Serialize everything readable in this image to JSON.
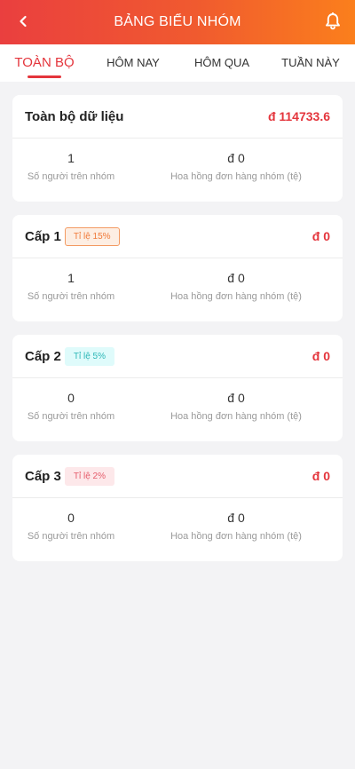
{
  "header": {
    "title": "BẢNG BIỂU NHÓM",
    "back_icon": "chevron-left-icon",
    "bell_icon": "bell-icon",
    "gradient_from": "#ea3f3f",
    "gradient_to": "#fb7f1c"
  },
  "tabs": [
    {
      "label": "TOÀN BỘ",
      "active": true
    },
    {
      "label": "HÔM NAY",
      "active": false
    },
    {
      "label": "HÔM QUA",
      "active": false
    },
    {
      "label": "TUẦN NÀY",
      "active": false
    }
  ],
  "accent": "#e4353c",
  "cards": [
    {
      "title": "Toàn bộ dữ liệu",
      "badge": "",
      "amount": "đ 114733.6",
      "members_value": "1",
      "members_label": "Số người trên nhóm",
      "commission_value": "đ 0",
      "commission_label": "Hoa hồng đơn hàng nhóm (tệ)"
    },
    {
      "title": "Cấp 1",
      "badge": "Tỉ lệ 15%",
      "amount": "đ 0",
      "members_value": "1",
      "members_label": "Số người trên nhóm",
      "commission_value": "đ 0",
      "commission_label": "Hoa hồng đơn hàng nhóm (tệ)"
    },
    {
      "title": "Cấp 2",
      "badge": "Tỉ lệ 5%",
      "amount": "đ 0",
      "members_value": "0",
      "members_label": "Số người trên nhóm",
      "commission_value": "đ 0",
      "commission_label": "Hoa hồng đơn hàng nhóm (tệ)"
    },
    {
      "title": "Cấp 3",
      "badge": "Tỉ lệ 2%",
      "amount": "đ 0",
      "members_value": "0",
      "members_label": "Số người trên nhóm",
      "commission_value": "đ 0",
      "commission_label": "Hoa hồng đơn hàng nhóm (tệ)"
    }
  ]
}
